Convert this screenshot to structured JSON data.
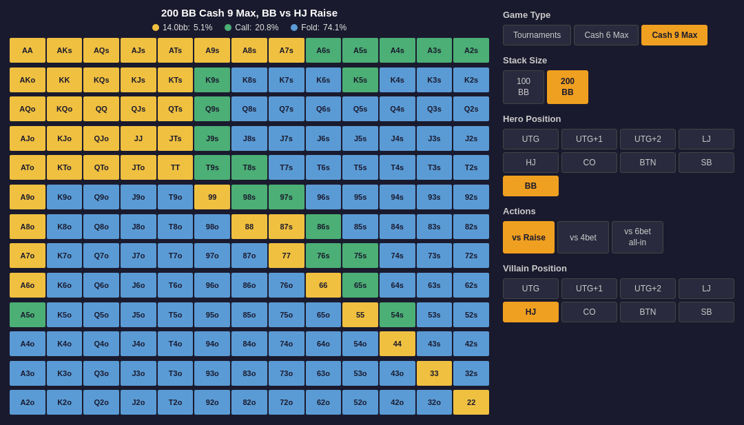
{
  "title": "200 BB Cash 9 Max, BB vs HJ Raise",
  "legend": {
    "raise": {
      "label": "14.0bb:",
      "pct": "5.1%",
      "color": "#f0c040"
    },
    "call": {
      "label": "Call:",
      "pct": "20.8%",
      "color": "#4caf75"
    },
    "fold": {
      "label": "Fold:",
      "pct": "74.1%",
      "color": "#5b9bd5"
    }
  },
  "gameType": {
    "label": "Game Type",
    "options": [
      "Tournaments",
      "Cash 6 Max",
      "Cash 9 Max"
    ],
    "active": "Cash 9 Max"
  },
  "stackSize": {
    "label": "Stack Size",
    "options": [
      {
        "label": "100\nBB",
        "value": "100BB"
      },
      {
        "label": "200\nBB",
        "value": "200BB"
      }
    ],
    "active": "200BB"
  },
  "heroPosition": {
    "label": "Hero Position",
    "positions": [
      "UTG",
      "UTG+1",
      "UTG+2",
      "LJ",
      "HJ",
      "CO",
      "BTN",
      "SB",
      "BB"
    ],
    "active": "BB"
  },
  "actions": {
    "label": "Actions",
    "options": [
      "vs Raise",
      "vs 4bet",
      "vs 6bet\nall-in"
    ],
    "active": "vs Raise"
  },
  "villainPosition": {
    "label": "Villain Position",
    "positions": [
      "UTG",
      "UTG+1",
      "UTG+2",
      "LJ",
      "HJ",
      "CO",
      "BTN",
      "SB"
    ],
    "active_primary": "HJ",
    "active_secondary": "CO"
  },
  "grid": [
    [
      "AA",
      "AKs",
      "AQs",
      "AJs",
      "ATs",
      "A9s",
      "A8s",
      "A7s",
      "A6s",
      "A5s",
      "A4s",
      "A3s",
      "A2s"
    ],
    [
      "AKo",
      "KK",
      "KQs",
      "KJs",
      "KTs",
      "K9s",
      "K8s",
      "K7s",
      "K6s",
      "K5s",
      "K4s",
      "K3s",
      "K2s"
    ],
    [
      "AQo",
      "KQo",
      "QQ",
      "QJs",
      "QTs",
      "Q9s",
      "Q8s",
      "Q7s",
      "Q6s",
      "Q5s",
      "Q4s",
      "Q3s",
      "Q2s"
    ],
    [
      "AJo",
      "KJo",
      "QJo",
      "JJ",
      "JTs",
      "J9s",
      "J8s",
      "J7s",
      "J6s",
      "J5s",
      "J4s",
      "J3s",
      "J2s"
    ],
    [
      "ATo",
      "KTo",
      "QTo",
      "JTo",
      "TT",
      "T9s",
      "T8s",
      "T7s",
      "T6s",
      "T5s",
      "T4s",
      "T3s",
      "T2s"
    ],
    [
      "A9o",
      "K9o",
      "Q9o",
      "J9o",
      "T9o",
      "99",
      "98s",
      "97s",
      "96s",
      "95s",
      "94s",
      "93s",
      "92s"
    ],
    [
      "A8o",
      "K8o",
      "Q8o",
      "J8o",
      "T8o",
      "98o",
      "88",
      "87s",
      "86s",
      "85s",
      "84s",
      "83s",
      "82s"
    ],
    [
      "A7o",
      "K7o",
      "Q7o",
      "J7o",
      "T7o",
      "97o",
      "87o",
      "77",
      "76s",
      "75s",
      "74s",
      "73s",
      "72s"
    ],
    [
      "A6o",
      "K6o",
      "Q6o",
      "J6o",
      "T6o",
      "96o",
      "86o",
      "76o",
      "66",
      "65s",
      "64s",
      "63s",
      "62s"
    ],
    [
      "A5o",
      "K5o",
      "Q5o",
      "J5o",
      "T5o",
      "95o",
      "85o",
      "75o",
      "65o",
      "55",
      "54s",
      "53s",
      "52s"
    ],
    [
      "A4o",
      "K4o",
      "Q4o",
      "J4o",
      "T4o",
      "94o",
      "84o",
      "74o",
      "64o",
      "54o",
      "44",
      "43s",
      "42s"
    ],
    [
      "A3o",
      "K3o",
      "Q3o",
      "J3o",
      "T3o",
      "93o",
      "83o",
      "73o",
      "63o",
      "53o",
      "43o",
      "33",
      "32s"
    ],
    [
      "A2o",
      "K2o",
      "Q2o",
      "J2o",
      "T2o",
      "92o",
      "82o",
      "72o",
      "62o",
      "52o",
      "42o",
      "32o",
      "22"
    ]
  ],
  "cellColors": {
    "AA": "yellow",
    "AKs": "yellow",
    "AQs": "yellow",
    "AJs": "yellow",
    "ATs": "yellow",
    "A9s": "yellow",
    "A8s": "yellow",
    "A7s": "yellow",
    "A6s": "green",
    "A5s": "green",
    "A4s": "green",
    "A3s": "green",
    "A2s": "green",
    "AKo": "yellow",
    "KK": "yellow",
    "KQs": "yellow",
    "KJs": "yellow",
    "KTs": "yellow",
    "K9s": "green",
    "K8s": "blue",
    "K7s": "blue",
    "K6s": "blue",
    "K5s": "green",
    "K4s": "blue",
    "K3s": "blue",
    "K2s": "blue",
    "AQo": "yellow",
    "KQo": "yellow",
    "QQ": "yellow",
    "QJs": "yellow",
    "QTs": "yellow",
    "Q9s": "green",
    "Q8s": "blue",
    "Q7s": "blue",
    "Q6s": "blue",
    "Q5s": "blue",
    "Q4s": "blue",
    "Q3s": "blue",
    "Q2s": "blue",
    "AJo": "yellow",
    "KJo": "yellow",
    "QJo": "yellow",
    "JJ": "yellow",
    "JTs": "yellow",
    "J9s": "green",
    "J8s": "blue",
    "J7s": "blue",
    "J6s": "blue",
    "J5s": "blue",
    "J4s": "blue",
    "J3s": "blue",
    "J2s": "blue",
    "ATo": "yellow",
    "KTo": "yellow",
    "QTo": "yellow",
    "JTo": "yellow",
    "TT": "yellow",
    "T9s": "green",
    "T8s": "green",
    "T7s": "blue",
    "T6s": "blue",
    "T5s": "blue",
    "T4s": "blue",
    "T3s": "blue",
    "T2s": "blue",
    "A9o": "yellow",
    "K9o": "blue",
    "Q9o": "blue",
    "J9o": "blue",
    "T9o": "blue",
    "99": "yellow",
    "98s": "green",
    "97s": "green",
    "96s": "blue",
    "95s": "blue",
    "94s": "blue",
    "93s": "blue",
    "92s": "blue",
    "A8o": "yellow",
    "K8o": "blue",
    "Q8o": "blue",
    "J8o": "blue",
    "T8o": "blue",
    "98o": "blue",
    "88": "yellow",
    "87s": "yellow",
    "86s": "green",
    "85s": "blue",
    "84s": "blue",
    "83s": "blue",
    "82s": "blue",
    "A7o": "yellow",
    "K7o": "blue",
    "Q7o": "blue",
    "J7o": "blue",
    "T7o": "blue",
    "97o": "blue",
    "87o": "blue",
    "77": "yellow",
    "76s": "green",
    "75s": "green",
    "74s": "blue",
    "73s": "blue",
    "72s": "blue",
    "A6o": "yellow",
    "K6o": "blue",
    "Q6o": "blue",
    "J6o": "blue",
    "T6o": "blue",
    "96o": "blue",
    "86o": "blue",
    "76o": "blue",
    "66": "yellow",
    "65s": "green",
    "64s": "blue",
    "63s": "blue",
    "62s": "blue",
    "A5o": "green",
    "K5o": "blue",
    "Q5o": "blue",
    "J5o": "blue",
    "T5o": "blue",
    "95o": "blue",
    "85o": "blue",
    "75o": "blue",
    "65o": "blue",
    "55": "yellow",
    "54s": "green",
    "53s": "blue",
    "52s": "blue",
    "A4o": "blue",
    "K4o": "blue",
    "Q4o": "blue",
    "J4o": "blue",
    "T4o": "blue",
    "94o": "blue",
    "84o": "blue",
    "74o": "blue",
    "64o": "blue",
    "54o": "blue",
    "44": "yellow",
    "43s": "blue",
    "42s": "blue",
    "A3o": "blue",
    "K3o": "blue",
    "Q3o": "blue",
    "J3o": "blue",
    "T3o": "blue",
    "93o": "blue",
    "83o": "blue",
    "73o": "blue",
    "63o": "blue",
    "53o": "blue",
    "43o": "blue",
    "33": "yellow",
    "32s": "blue",
    "A2o": "blue",
    "K2o": "blue",
    "Q2o": "blue",
    "J2o": "blue",
    "T2o": "blue",
    "92o": "blue",
    "82o": "blue",
    "72o": "blue",
    "62o": "blue",
    "52o": "blue",
    "42o": "blue",
    "32o": "blue",
    "22": "yellow"
  }
}
